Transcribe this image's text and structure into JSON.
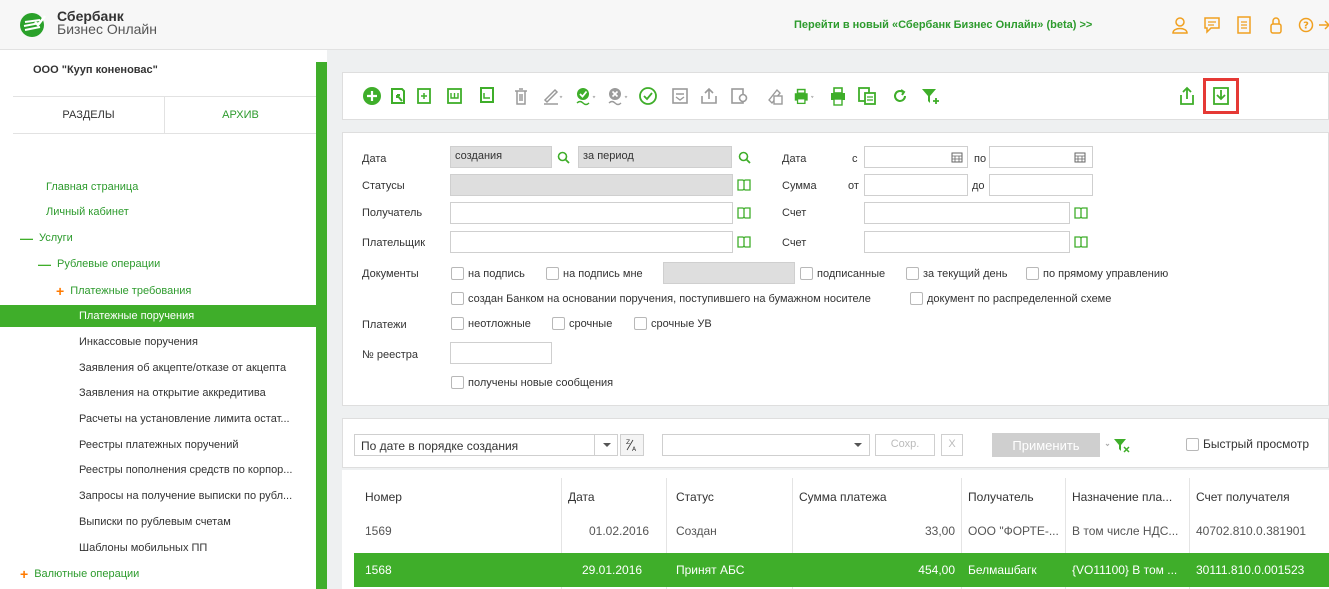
{
  "header": {
    "brand_line1": "Сбербанк",
    "brand_line2": "Бизнес Онлайн",
    "new_version_link": "Перейти в новый «Сбербанк Бизнес Онлайн» (beta) >>",
    "icons": [
      "user-icon",
      "chat-icon",
      "document-icon",
      "lock-icon",
      "help-icon",
      "logout-icon"
    ]
  },
  "sidebar": {
    "org_name": "ООО \"Кууп коненовас\"",
    "tabs": [
      "РАЗДЕЛЫ",
      "АРХИВ"
    ],
    "items": [
      {
        "label": "Главная страница"
      },
      {
        "label": "Личный кабинет"
      },
      {
        "label": "Услуги"
      },
      {
        "label": "Рублевые операции"
      },
      {
        "label": "Платежные требования"
      },
      {
        "label": "Платежные поручения"
      },
      {
        "label": "Инкассовые поручения"
      },
      {
        "label": "Заявления об акцепте/отказе от акцепта"
      },
      {
        "label": "Заявления на открытие аккредитива"
      },
      {
        "label": "Расчеты на установление лимита остат..."
      },
      {
        "label": "Реестры платежных поручений"
      },
      {
        "label": "Реестры пополнения средств по корпор..."
      },
      {
        "label": "Запросы на получение выписки по рубл..."
      },
      {
        "label": "Выписки по рублевым счетам"
      },
      {
        "label": "Шаблоны мобильных ПП"
      },
      {
        "label": "Валютные операции"
      }
    ]
  },
  "toolbar": {
    "icons": [
      "add-icon",
      "open-icon",
      "copy-icon",
      "copy-template-icon",
      "create-from-template-icon",
      "delete-icon",
      "edit-icon",
      "sign-icon",
      "remove-sign-icon",
      "check-icon",
      "send-icon",
      "export-icon",
      "print-preview-icon",
      "notes-icon",
      "print-icon",
      "print-list-icon",
      "archive-icon",
      "refresh-icon",
      "filter-icon",
      "upload-icon",
      "download-icon"
    ]
  },
  "filter": {
    "date_label": "Дата",
    "date_type": "создания",
    "date_period": "за период",
    "date2_label": "Дата",
    "date_from_label": "с",
    "date_to_label": "по",
    "statuses_label": "Статусы",
    "amount_label": "Сумма",
    "amount_from_label": "от",
    "amount_to_label": "до",
    "recipient_label": "Получатель",
    "account_label": "Счет",
    "payer_label": "Плательщик",
    "account2_label": "Счет",
    "documents_label": "Документы",
    "cb_for_sign": "на подпись",
    "cb_for_sign_me": "на подпись мне",
    "cb_signed": "подписанные",
    "cb_today": "за текущий день",
    "cb_direct": "по прямому управлению",
    "cb_created_by_bank": "создан Банком на основании поручения, поступившего на бумажном носителе",
    "cb_distributed": "документ по распределенной схеме",
    "payments_label": "Платежи",
    "cb_urgent": "неотложные",
    "cb_fast": "срочные",
    "cb_fast_uv": "срочные УВ",
    "registry_label": "№ реестра",
    "cb_new_messages": "получены новые сообщения"
  },
  "sortbar": {
    "sort_value": "По дате в порядке создания",
    "save_label": "Сохр.",
    "clear_label": "X",
    "apply_label": "Применить",
    "quick_view_label": "Быстрый просмотр"
  },
  "table": {
    "columns": [
      "Номер",
      "Дата",
      "Статус",
      "Сумма платежа",
      "Получатель",
      "Назначение пла...",
      "Счет получателя"
    ],
    "rows": [
      [
        "1569",
        "01.02.2016",
        "Создан",
        "33,00",
        "ООО \"ФОРТЕ-...",
        "В том числе НДС...",
        "40702.810.0.381901"
      ],
      [
        "1568",
        "29.01.2016",
        "Принят АБС",
        "454,00",
        "Белмашбагк",
        "{VO11100} В том ...",
        "30111.810.0.001523"
      ]
    ]
  },
  "colors": {
    "accent_green": "#3fae2a",
    "link_green": "#2d9b2d",
    "highlight_red": "#e53935"
  }
}
